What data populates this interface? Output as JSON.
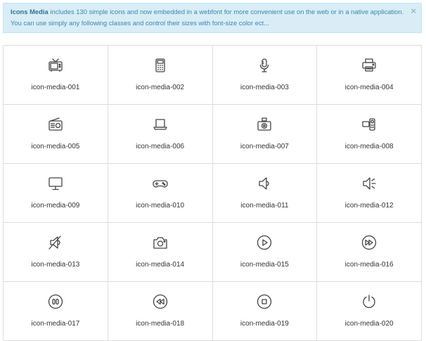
{
  "alert": {
    "title": "Icons Media",
    "text": " includes 130 simple icons and now embedded in a webfont for more convenient use on the web or in a native application. You can use simply any following classes and control their sizes with font-size color ect...",
    "close": "×"
  },
  "icons": [
    {
      "label": "icon-media-001",
      "icon": "tv-icon"
    },
    {
      "label": "icon-media-002",
      "icon": "calculator-icon"
    },
    {
      "label": "icon-media-003",
      "icon": "microphone-icon"
    },
    {
      "label": "icon-media-004",
      "icon": "printer-icon"
    },
    {
      "label": "icon-media-005",
      "icon": "radio-icon"
    },
    {
      "label": "icon-media-006",
      "icon": "laptop-icon"
    },
    {
      "label": "icon-media-007",
      "icon": "camera-icon"
    },
    {
      "label": "icon-media-008",
      "icon": "video-camera-icon"
    },
    {
      "label": "icon-media-009",
      "icon": "monitor-icon"
    },
    {
      "label": "icon-media-010",
      "icon": "gamepad-icon"
    },
    {
      "label": "icon-media-011",
      "icon": "speaker-icon"
    },
    {
      "label": "icon-media-012",
      "icon": "volume-icon"
    },
    {
      "label": "icon-media-013",
      "icon": "mute-icon"
    },
    {
      "label": "icon-media-014",
      "icon": "photo-camera-icon"
    },
    {
      "label": "icon-media-015",
      "icon": "play-icon"
    },
    {
      "label": "icon-media-016",
      "icon": "fast-forward-icon"
    },
    {
      "label": "icon-media-017",
      "icon": "pause-icon"
    },
    {
      "label": "icon-media-018",
      "icon": "rewind-icon"
    },
    {
      "label": "icon-media-019",
      "icon": "stop-icon"
    },
    {
      "label": "icon-media-020",
      "icon": "power-icon"
    }
  ]
}
